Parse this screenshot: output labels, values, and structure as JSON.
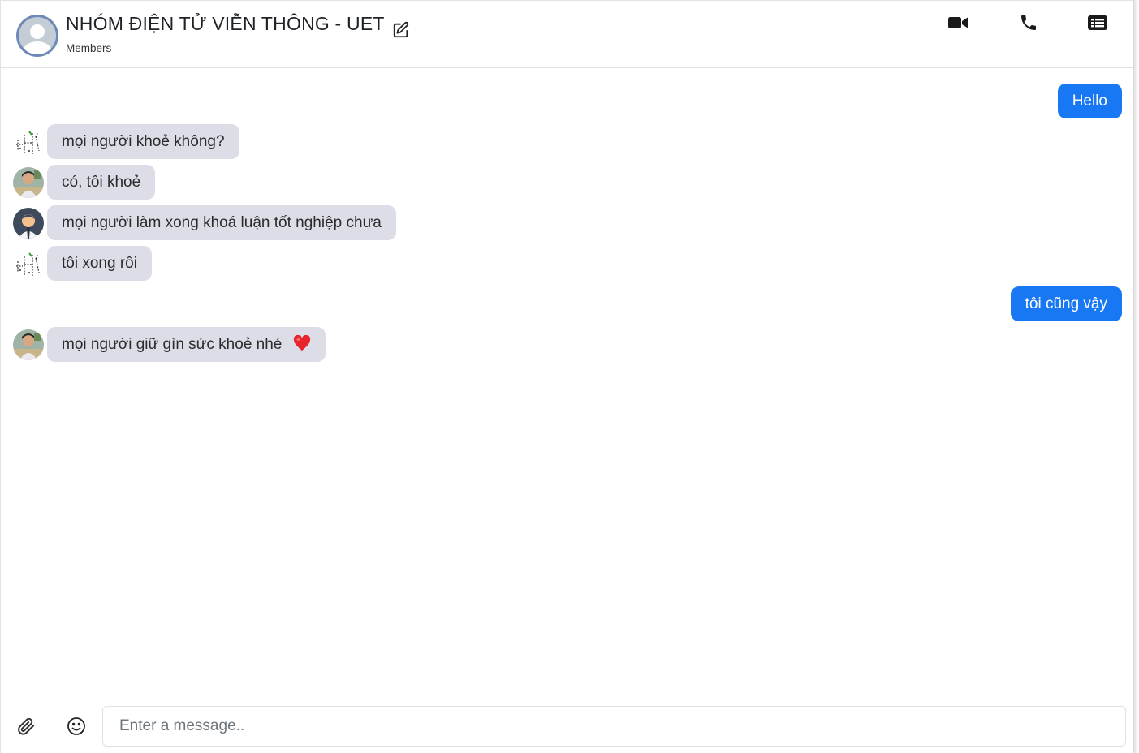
{
  "header": {
    "group_name": "NHÓM ĐIỆN TỬ VIỄN THÔNG - UET",
    "subtitle": "Members",
    "icons": [
      "group-avatar-icon",
      "edit-icon",
      "video-call-icon",
      "phone-icon",
      "list-icon"
    ]
  },
  "messages": [
    {
      "direction": "outgoing",
      "text": "Hello"
    },
    {
      "direction": "incoming",
      "sender_avatar": "avatar-sketch",
      "text": "mọi người khoẻ không?"
    },
    {
      "direction": "incoming",
      "sender_avatar": "avatar-photo",
      "text": "có, tôi khoẻ"
    },
    {
      "direction": "incoming",
      "sender_avatar": "avatar-default-person",
      "text": "mọi người làm xong khoá luận tốt nghiệp chưa"
    },
    {
      "direction": "incoming",
      "sender_avatar": "avatar-sketch",
      "text": "tôi xong rồi"
    },
    {
      "direction": "outgoing",
      "text": "tôi cũng vậy"
    },
    {
      "direction": "incoming",
      "sender_avatar": "avatar-photo",
      "text": "mọi người giữ gìn sức khoẻ nhé",
      "emoji": "heart-icon"
    }
  ],
  "composer": {
    "placeholder": "Enter a message..",
    "value": ""
  },
  "colors": {
    "outgoing_bubble": "#1877f2",
    "incoming_bubble": "#dcdde6",
    "heart": "#e8242f"
  }
}
